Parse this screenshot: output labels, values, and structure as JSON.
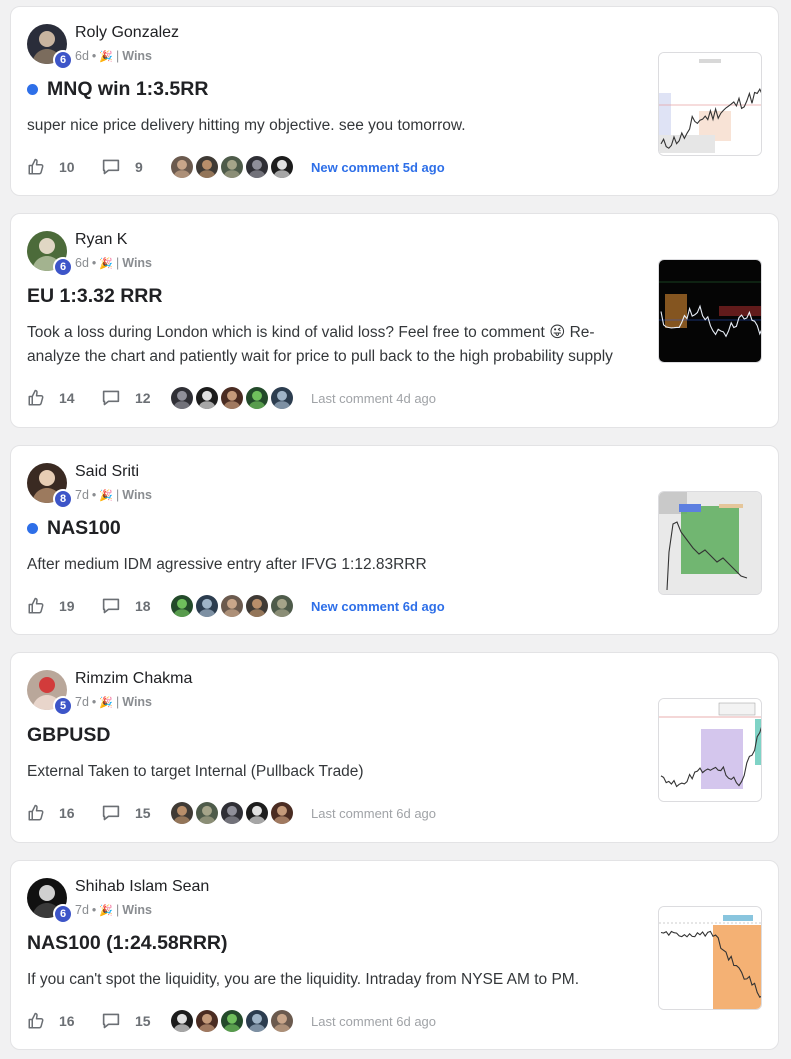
{
  "posts": [
    {
      "author": "Roly Gonzalez",
      "level": "6",
      "time": "6d",
      "category": "Wins",
      "title": "MNQ win 1:3.5RR",
      "unread": true,
      "body": "super nice price delivery hitting my objective. see you tomorrow.",
      "likes": "10",
      "comments": "9",
      "last_comment": "New comment 5d ago",
      "new_comment": true
    },
    {
      "author": "Ryan K",
      "level": "6",
      "time": "6d",
      "category": "Wins",
      "title": "EU 1:3.32 RRR",
      "unread": false,
      "body": "Took a loss during London which is kind of valid loss? Feel free to comment 😜 Re-analyze the chart and patiently wait for price to pull back to the high probability supply",
      "likes": "14",
      "comments": "12",
      "last_comment": "Last comment 4d ago",
      "new_comment": false
    },
    {
      "author": "Said Sriti",
      "level": "8",
      "time": "7d",
      "category": "Wins",
      "title": "NAS100",
      "unread": true,
      "body": "After medium IDM agressive entry after IFVG 1:12.83RRR",
      "likes": "19",
      "comments": "18",
      "last_comment": "New comment 6d ago",
      "new_comment": true
    },
    {
      "author": "Rimzim Chakma",
      "level": "5",
      "time": "7d",
      "category": "Wins",
      "title": "GBPUSD",
      "unread": false,
      "body": "External Taken to target Internal (Pullback Trade)",
      "likes": "16",
      "comments": "15",
      "last_comment": "Last comment 6d ago",
      "new_comment": false
    },
    {
      "author": "Shihab Islam Sean",
      "level": "6",
      "time": "7d",
      "category": "Wins",
      "title": "NAS100 (1:24.58RRR)",
      "unread": false,
      "body": "If you can't spot the liquidity, you are the liquidity. Intraday from NYSE AM to PM.",
      "likes": "16",
      "comments": "15",
      "last_comment": "Last comment 6d ago",
      "new_comment": false
    }
  ],
  "separator": "•",
  "category_separator": "|",
  "icons": {
    "like": "thumbs-up-icon",
    "comment": "comment-icon",
    "category": "party-popper-icon"
  },
  "colors": {
    "accent_blue": "#2e6fe8",
    "level_badge": "#3d55c8",
    "muted_text": "#8a8d91"
  }
}
